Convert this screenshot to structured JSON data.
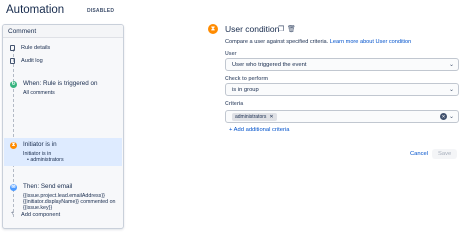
{
  "header": {
    "title": "Automation",
    "status_badge": "DISABLED"
  },
  "sidebar": {
    "heading": "Comment",
    "items": [
      {
        "label": "Rule details",
        "icon": "document-icon"
      },
      {
        "label": "Audit log",
        "icon": "document-icon"
      }
    ],
    "trigger": {
      "title": "When: Rule is triggered on",
      "detail": "All comments",
      "color": "#36b37e"
    },
    "condition": {
      "title": "Initiator is in",
      "detail_line1": "Initiator is in",
      "detail_line2": "• administrators",
      "color": "#ff8b00"
    },
    "action": {
      "title": "Then: Send email",
      "lines": [
        "{{issue.project.lead.emailAddress}}",
        "{{initiator.displayName}} commented on",
        "{{issue.key}}"
      ],
      "color": "#4c9aff"
    },
    "add_component": "Add component"
  },
  "editor": {
    "title": "User condition",
    "description": "Compare a user against specified criteria.",
    "learn_more": "Learn more about User condition",
    "user": {
      "label": "User",
      "value": "User who triggered the event"
    },
    "check": {
      "label": "Check to perform",
      "value": "is in group"
    },
    "criteria": {
      "label": "Criteria",
      "chip": "administrators"
    },
    "add_criteria": "+ Add additional criteria",
    "cancel": "Cancel",
    "save": "Save"
  }
}
